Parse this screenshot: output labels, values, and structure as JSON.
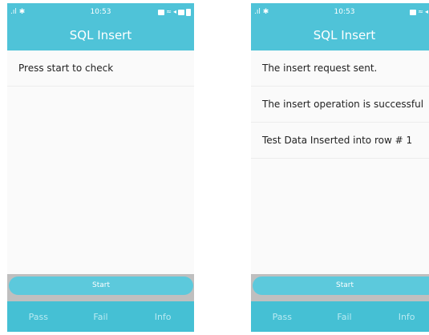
{
  "colors": {
    "accent": "#4fc3d8",
    "start_button": "#5cc9dc",
    "bottom_bar": "#45c0d4",
    "bottom_text": "#b9eaf2",
    "start_strip": "#bfbfbf"
  },
  "screens": [
    {
      "statusbar": {
        "time": "10:53",
        "icons": [
          "signal-icon",
          "bluetooth-icon",
          "notification-icon",
          "wifi-icon",
          "mute-icon",
          "battery-icon"
        ]
      },
      "title": "SQL Insert",
      "rows": [
        "Press start to check"
      ],
      "start_label": "Start",
      "bottom": {
        "pass": "Pass",
        "fail": "Fail",
        "info": "Info"
      }
    },
    {
      "statusbar": {
        "time": "10:53",
        "icons": [
          "signal-icon",
          "bluetooth-icon",
          "notification-icon",
          "wifi-icon",
          "mute-icon",
          "battery-icon"
        ]
      },
      "title": "SQL Insert",
      "rows": [
        "The insert request sent.",
        "The insert operation is successful",
        "Test Data Inserted into row # 1"
      ],
      "start_label": "Start",
      "bottom": {
        "pass": "Pass",
        "fail": "Fail",
        "info": "Info"
      }
    }
  ]
}
